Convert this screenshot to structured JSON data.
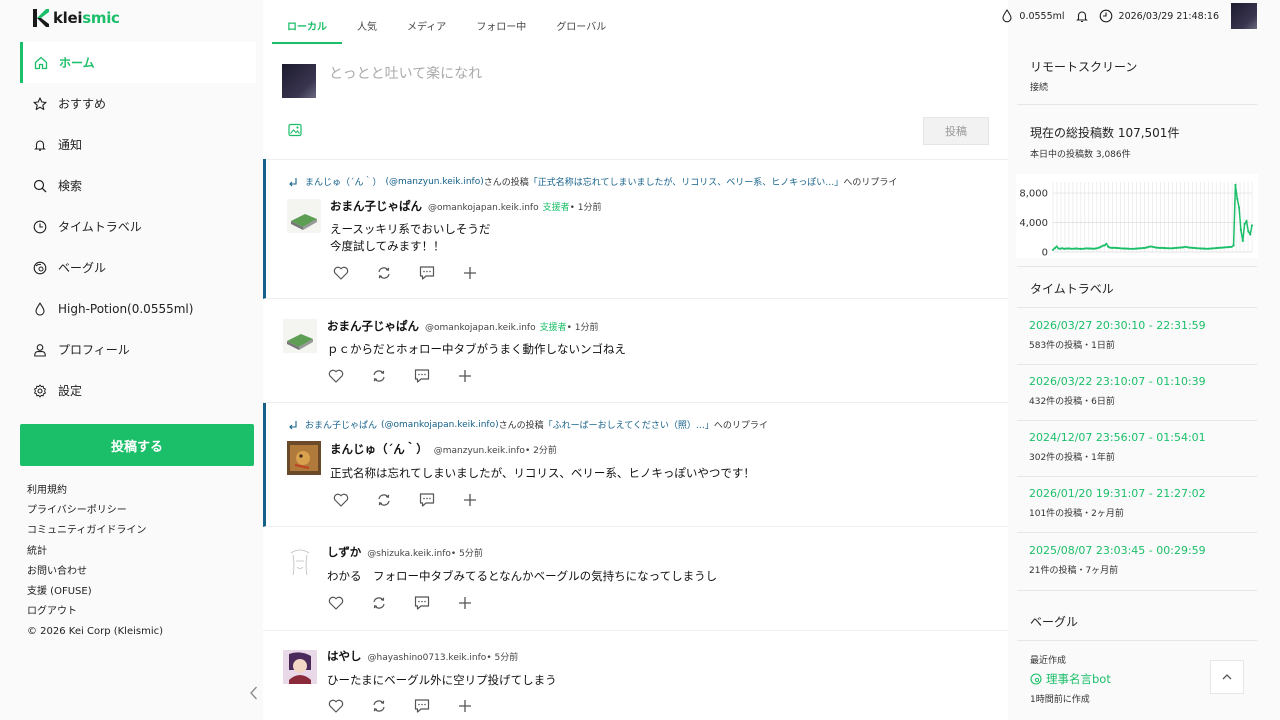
{
  "app": {
    "name_prefix": "klei",
    "name_accent": "smic"
  },
  "sidebar": {
    "items": [
      {
        "label": "ホーム",
        "icon": "home-icon",
        "active": true
      },
      {
        "label": "おすすめ",
        "icon": "star-icon"
      },
      {
        "label": "通知",
        "icon": "bell-icon"
      },
      {
        "label": "検索",
        "icon": "search-icon"
      },
      {
        "label": "タイムトラベル",
        "icon": "clock-icon"
      },
      {
        "label": "ベーグル",
        "icon": "bagel-icon"
      },
      {
        "label": "High-Potion(0.0555ml)",
        "icon": "droplet-icon"
      },
      {
        "label": "プロフィール",
        "icon": "user-icon"
      },
      {
        "label": "設定",
        "icon": "gear-icon"
      }
    ],
    "post_button": "投稿する",
    "footer_links": [
      "利用規約",
      "プライバシーポリシー",
      "コミュニティガイドライン",
      "統計",
      "お問い合わせ",
      "支援 (OFUSE)",
      "ログアウト"
    ],
    "copyright": "© 2026 Kei Corp (Kleismic)"
  },
  "tabs": [
    "ローカル",
    "人気",
    "メディア",
    "フォロー中",
    "グローバル"
  ],
  "composer": {
    "placeholder": "とっとと吐いて楽になれ",
    "submit": "投稿"
  },
  "posts": [
    {
      "reply_name": "まんじゅ（´ん｀）",
      "reply_handle": "(@manzyun.keik.info)",
      "reply_mid": " さんの投稿",
      "reply_quote": "「正式名称は忘れてしまいましたが、リコリス、ベリー系、ヒノキっぽい…」",
      "reply_suffix": " へのリプライ",
      "name": "おまん子じゃぱん",
      "handle": "@omankojapan.keik.info",
      "badge": "支援者",
      "time": " • 1分前",
      "body": [
        "えースッキリ系でおいしそうだ",
        "今度試してみます！！"
      ]
    },
    {
      "name": "おまん子じゃぱん",
      "handle": "@omankojapan.keik.info",
      "badge": "支援者",
      "time": " • 1分前",
      "body": [
        "ｐｃからだとホォロー中タブがうまく動作しないンゴねえ"
      ]
    },
    {
      "reply_name": "おまん子じゃぱん",
      "reply_handle": "(@omankojapan.keik.info)",
      "reply_mid": " さんの投稿",
      "reply_quote": "「ふれーばーおしえてください（照）…」",
      "reply_suffix": " へのリプライ",
      "name": "まんじゅ（´ん｀）",
      "handle": "@manzyun.keik.info",
      "time": " • 2分前",
      "body": [
        "正式名称は忘れてしまいましたが、リコリス、ベリー系、ヒノキっぽいやつです！"
      ]
    },
    {
      "name": "しずか",
      "handle": "@shizuka.keik.info",
      "time": " • 5分前",
      "body": [
        "わかる　フォロー中タブみてるとなんかベーグルの気持ちになってしまうし"
      ]
    },
    {
      "name": "はやし",
      "handle": "@hayashino0713.keik.info",
      "time": " • 5分前",
      "body": [
        "ひーたまにベーグル外に空リプ投げてしまう"
      ]
    }
  ],
  "topbar": {
    "potion": "0.0555ml",
    "datetime": "2026/03/29 21:48:16"
  },
  "right": {
    "remote_title": "リモートスクリーン",
    "remote_status": "接続",
    "total_title": "現在の総投稿数 107,501件",
    "today": "本日中の投稿数 3,086件",
    "timetravel_title": "タイムトラベル",
    "timetravel": [
      {
        "range": "2026/03/27 20:30:10 - 22:31:59",
        "meta": "583件の投稿・1日前"
      },
      {
        "range": "2026/03/22 23:10:07 - 01:10:39",
        "meta": "432件の投稿・6日前"
      },
      {
        "range": "2024/12/07 23:56:07 - 01:54:01",
        "meta": "302件の投稿・1年前"
      },
      {
        "range": "2026/01/20 19:31:07 - 21:27:02",
        "meta": "101件の投稿・2ヶ月前"
      },
      {
        "range": "2025/08/07 23:03:45 - 00:29:59",
        "meta": "21件の投稿・7ヶ月前"
      }
    ],
    "bagel_title": "ベーグル",
    "recent_label": "最近作成",
    "bot_name": "理事名言bot",
    "bot_time": "1時間前に作成"
  },
  "chart_data": {
    "type": "line",
    "ylim": [
      0,
      9500
    ],
    "yticks": [
      "0",
      "4,000",
      "8,000"
    ],
    "ytick_values": [
      0,
      4000,
      8000
    ],
    "color": "#1cbf69",
    "values": [
      300,
      520,
      750,
      480,
      450,
      510,
      440,
      460,
      470,
      480,
      430,
      450,
      460,
      470,
      440,
      420,
      430,
      450,
      500,
      470,
      480,
      460,
      440,
      470,
      520,
      600,
      700,
      850,
      900,
      1100,
      700,
      600,
      550,
      580,
      560,
      540,
      520,
      500,
      480,
      470,
      460,
      450,
      440,
      430,
      440,
      460,
      480,
      500,
      520,
      540,
      560,
      620,
      700,
      750,
      700,
      650,
      600,
      580,
      560,
      550,
      540,
      530,
      520,
      510,
      500,
      520,
      540,
      560,
      580,
      600,
      620,
      650,
      700,
      650,
      600,
      580,
      560,
      540,
      520,
      500,
      480,
      470,
      460,
      450,
      440,
      460,
      480,
      500,
      520,
      540,
      560,
      580,
      600,
      620,
      640,
      660,
      680,
      700,
      900,
      9100,
      7200,
      6000,
      3000,
      1500,
      3800,
      4200,
      2800,
      2400,
      3600
    ]
  }
}
